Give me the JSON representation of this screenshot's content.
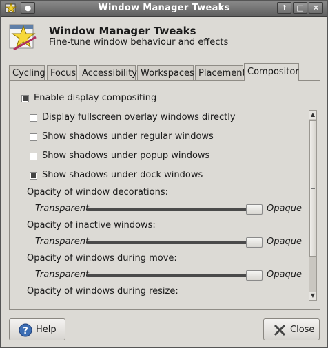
{
  "window": {
    "title": "Window Manager Tweaks"
  },
  "header": {
    "title": "Window Manager Tweaks",
    "subtitle": "Fine-tune window behaviour and effects",
    "icon": "star-wand-icon"
  },
  "tabs": [
    {
      "label": "Cycling",
      "active": false
    },
    {
      "label": "Focus",
      "active": false
    },
    {
      "label": "Accessibility",
      "active": false
    },
    {
      "label": "Workspaces",
      "active": false
    },
    {
      "label": "Placement",
      "active": false
    },
    {
      "label": "Compositor",
      "active": true
    }
  ],
  "compositor": {
    "enable_label": "Enable display compositing",
    "enable_checked": true,
    "options": [
      {
        "label": "Display fullscreen overlay windows directly",
        "checked": false
      },
      {
        "label": "Show shadows under regular windows",
        "checked": false
      },
      {
        "label": "Show shadows under popup windows",
        "checked": false
      },
      {
        "label": "Show shadows under dock windows",
        "checked": true
      }
    ],
    "sliders": [
      {
        "label": "Opacity of window decorations:",
        "left": "Transparent",
        "right": "Opaque",
        "value_percent": 100
      },
      {
        "label": "Opacity of inactive windows:",
        "left": "Transparent",
        "right": "Opaque",
        "value_percent": 100
      },
      {
        "label": "Opacity of windows during move:",
        "left": "Transparent",
        "right": "Opaque",
        "value_percent": 100
      }
    ],
    "last_label": "Opacity of windows during resize:"
  },
  "buttons": {
    "help": "Help",
    "close": "Close"
  }
}
